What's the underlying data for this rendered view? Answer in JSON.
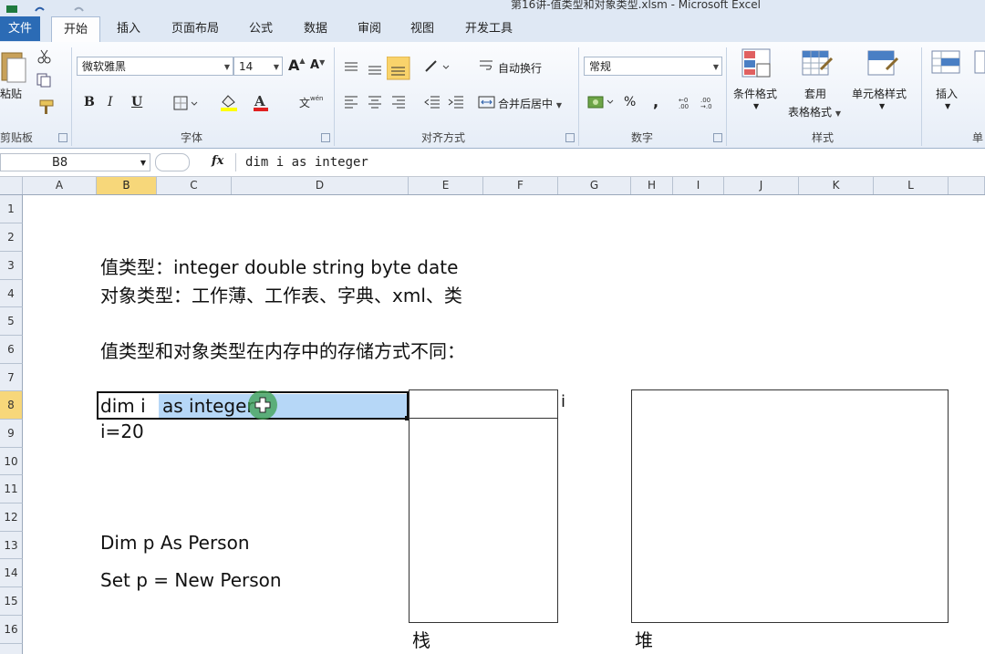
{
  "window": {
    "title": "第16讲-值类型和对象类型.xlsm - Microsoft Excel"
  },
  "tabs": [
    {
      "label": "文件"
    },
    {
      "label": "开始"
    },
    {
      "label": "插入"
    },
    {
      "label": "页面布局"
    },
    {
      "label": "公式"
    },
    {
      "label": "数据"
    },
    {
      "label": "审阅"
    },
    {
      "label": "视图"
    },
    {
      "label": "开发工具"
    }
  ],
  "ribbon": {
    "clipboard": {
      "paste": "粘贴",
      "label": "剪贴板"
    },
    "font": {
      "name": "微软雅黑",
      "size": "14",
      "label": "字体",
      "bold": "B",
      "italic": "I",
      "underline": "U",
      "grow": "A",
      "shrink": "A"
    },
    "alignment": {
      "wrap": "自动换行",
      "merge": "合并后居中",
      "label": "对齐方式"
    },
    "number": {
      "format": "常规",
      "label": "数字",
      "percent": "%",
      "comma": ","
    },
    "styles": {
      "conditional": "条件格式",
      "table_format_1": "套用",
      "table_format_2": "表格格式",
      "cell_styles": "单元格样式",
      "label": "样式"
    },
    "cells": {
      "insert": "插入",
      "label": "单"
    }
  },
  "formula_bar": {
    "name_box": "B8",
    "fx": "fx",
    "formula": "dim i   as integer"
  },
  "columns": [
    "A",
    "B",
    "C",
    "D",
    "E",
    "F",
    "G",
    "H",
    "I",
    "J",
    "K",
    "L"
  ],
  "rows": [
    "1",
    "2",
    "3",
    "4",
    "5",
    "6",
    "7",
    "8",
    "9",
    "10",
    "11",
    "12",
    "13",
    "14",
    "15",
    "16"
  ],
  "selected_cell": "B8",
  "content": {
    "line3": "值类型：integer    double  string    byte  date",
    "line4": "对象类型：工作薄、工作表、字典、xml、类",
    "line6": "值类型和对象类型在内存中的存储方式不同：",
    "b8_part1": "dim i ",
    "b8_part2": "as integer",
    "line9": "i=20",
    "line13": "Dim p As Person",
    "line14": "Set p = New Person",
    "stack_var": "i",
    "stack_label": "栈",
    "heap_label": "堆"
  }
}
